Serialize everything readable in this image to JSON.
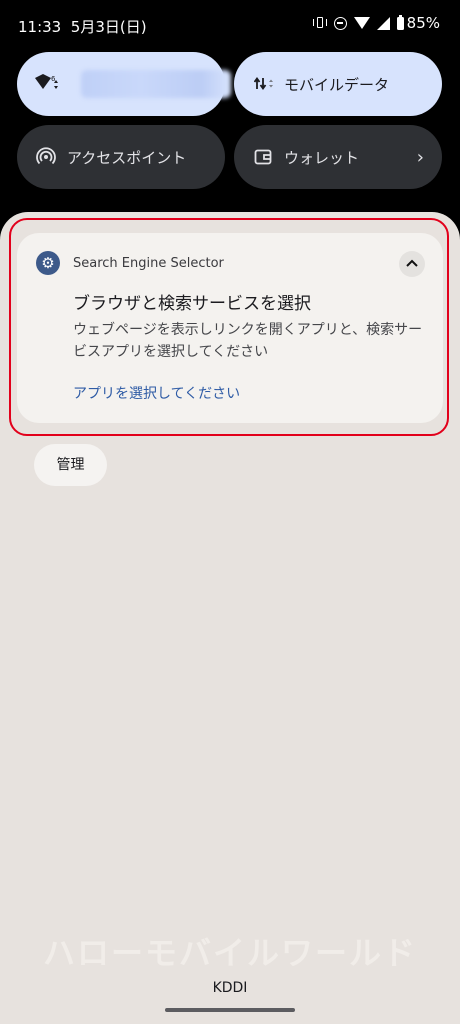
{
  "status_bar": {
    "time": "11:33",
    "date": "5月3日(日)",
    "battery": "85%",
    "icons": [
      "vibrate-icon",
      "do-not-disturb-icon",
      "wifi-icon",
      "signal-icon",
      "battery-icon"
    ]
  },
  "quick_settings": {
    "wifi_tile": {
      "icon": "wifi-icon",
      "label": ""
    },
    "mobile_data_tile": {
      "icon": "data-arrows-icon",
      "label": "モバイルデータ"
    },
    "hotspot_tile": {
      "icon": "hotspot-icon",
      "label": "アクセスポイント"
    },
    "wallet_tile": {
      "icon": "wallet-icon",
      "label": "ウォレット"
    }
  },
  "notification": {
    "app_name": "Search Engine Selector",
    "title": "ブラウザと検索サービスを選択",
    "body": "ウェブページを表示しリンクを開くアプリと、検索サービスアプリを選択してください",
    "action": "アプリを選択してください"
  },
  "manage_button": "管理",
  "watermark": "ハローモバイルワールド",
  "carrier": "KDDI",
  "colors": {
    "shade_bg": "#e7e2de",
    "tile_active": "#d7e3fd",
    "tile_inactive": "#2e3034",
    "highlight": "#e2001b",
    "action_link": "#2e5ba5"
  }
}
